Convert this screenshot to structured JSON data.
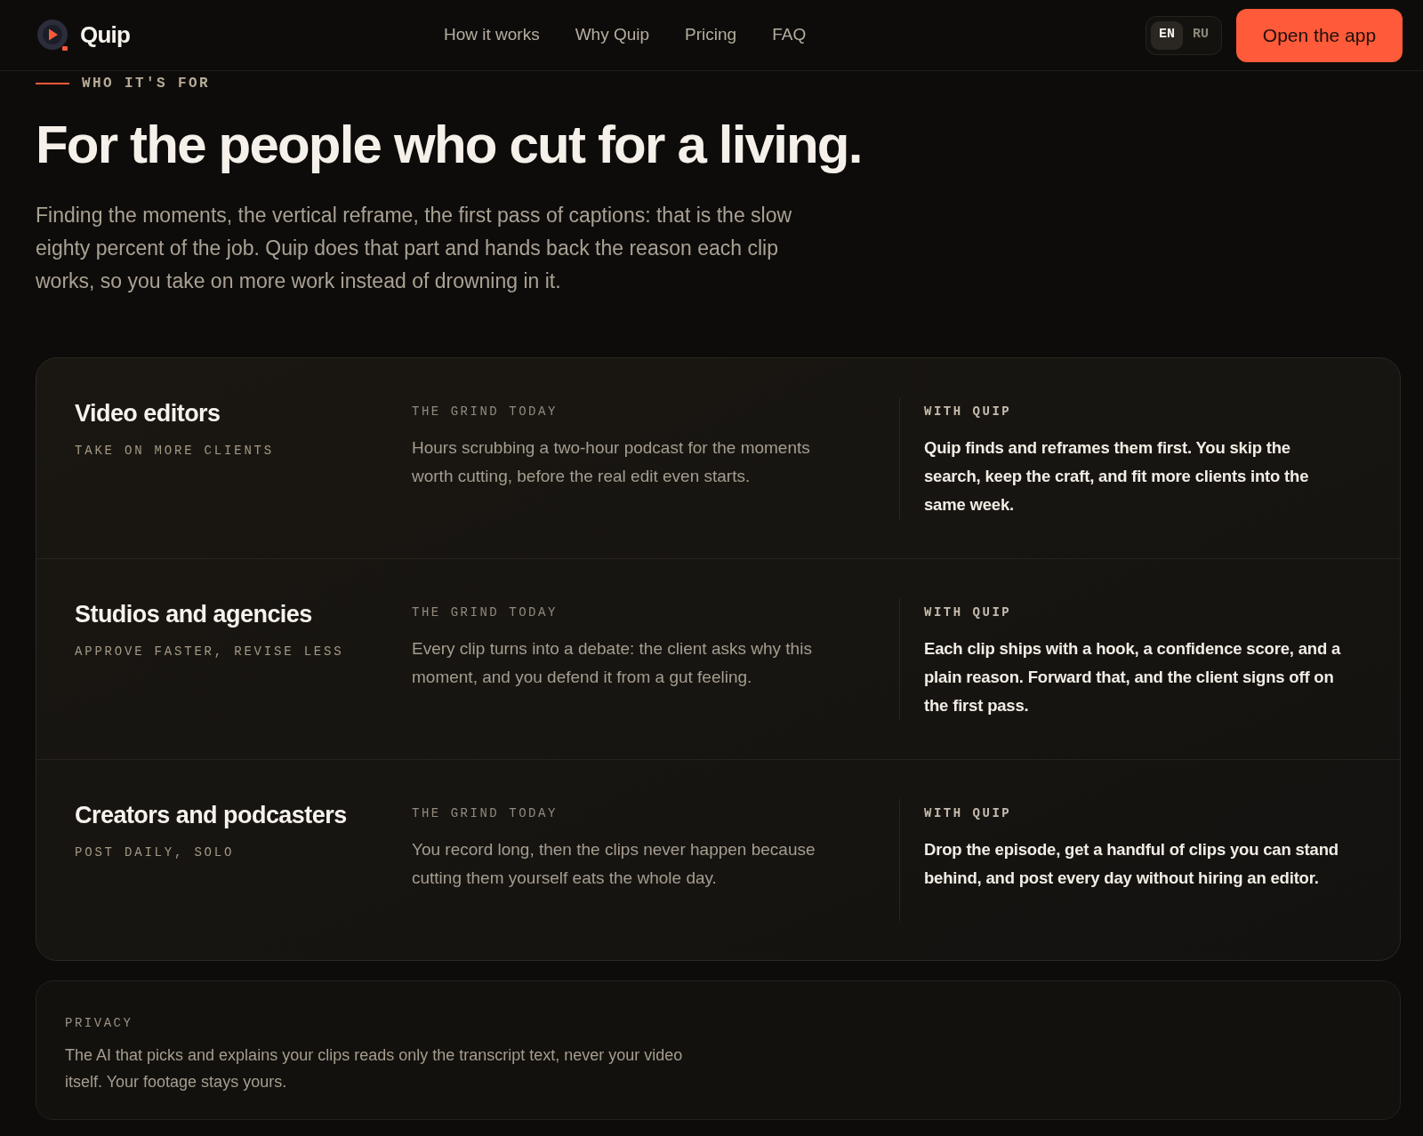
{
  "header": {
    "brand": "Quip",
    "nav": [
      {
        "label": "How it works"
      },
      {
        "label": "Why Quip"
      },
      {
        "label": "Pricing"
      },
      {
        "label": "FAQ"
      }
    ],
    "languages": [
      {
        "label": "EN",
        "selected": true
      },
      {
        "label": "RU",
        "selected": false
      }
    ],
    "cta": "Open the app"
  },
  "section": {
    "eyebrow": "WHO IT'S FOR",
    "heading": "For the people who cut for a living.",
    "intro": "Finding the moments, the vertical reframe, the first pass of captions: that is the slow eighty percent of the job. Quip does that part and hands back the reason each clip works, so you take on more work instead of drowning in it."
  },
  "audiences": [
    {
      "title": "Video editors",
      "tagline": "TAKE ON MORE CLIENTS",
      "grind_label": "THE GRIND TODAY",
      "grind": "Hours scrubbing a two-hour podcast for the moments worth cutting, before the real edit even starts.",
      "quip_label": "WITH QUIP",
      "quip": "Quip finds and reframes them first. You skip the search, keep the craft, and fit more clients into the same week."
    },
    {
      "title": "Studios and agencies",
      "tagline": "APPROVE FASTER, REVISE LESS",
      "grind_label": "THE GRIND TODAY",
      "grind": "Every clip turns into a debate: the client asks why this moment, and you defend it from a gut feeling.",
      "quip_label": "WITH QUIP",
      "quip": "Each clip ships with a hook, a confidence score, and a plain reason. Forward that, and the client signs off on the first pass."
    },
    {
      "title": "Creators and podcasters",
      "tagline": "POST DAILY, SOLO",
      "grind_label": "THE GRIND TODAY",
      "grind": "You record long, then the clips never happen because cutting them yourself eats the whole day.",
      "quip_label": "WITH QUIP",
      "quip": "Drop the episode, get a handful of clips you can stand behind, and post every day without hiring an editor."
    }
  ],
  "privacy": {
    "label": "PRIVACY",
    "text": "The AI that picks and explains your clips reads only the transcript text, never your video itself. Your footage stays yours."
  }
}
